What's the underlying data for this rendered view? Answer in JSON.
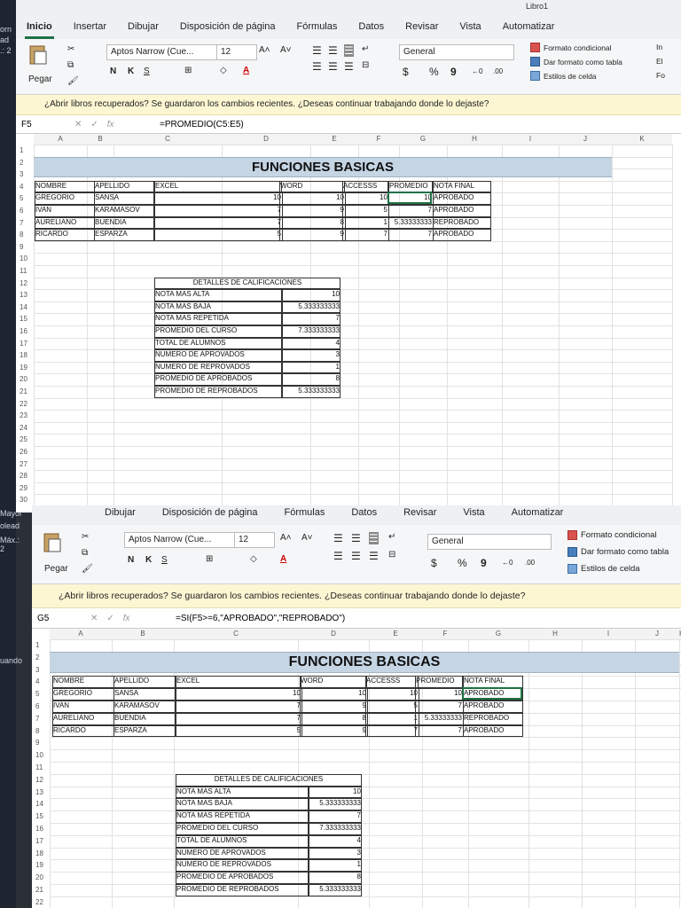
{
  "desktop_fragments": [
    "orn",
    "ad",
    ".: 2",
    "Mayor",
    "olead",
    "Máx.: 2",
    "uando"
  ],
  "window_title": "Libro1",
  "tabs": [
    "Inicio",
    "Insertar",
    "Dibujar",
    "Disposición de página",
    "Fórmulas",
    "Datos",
    "Revisar",
    "Vista",
    "Automatizar"
  ],
  "tabs_w2": [
    "Dibujar",
    "Disposición de página",
    "Fórmulas",
    "Datos",
    "Revisar",
    "Vista",
    "Automatizar"
  ],
  "ribbon": {
    "paste_label": "Pegar",
    "font_name": "Aptos Narrow (Cue...",
    "font_size": "12",
    "bold": "N",
    "italic": "K",
    "underline": "S",
    "number_format": "General",
    "currency": "$",
    "percent": "%",
    "thousands": "9",
    "cond_format": "Formato condicional",
    "table_format": "Dar formato como tabla",
    "cell_styles": "Estilos de celda",
    "insert_partial": "In",
    "delete_partial": "El",
    "format_partial": "Fo"
  },
  "banner_text": "¿Abrir libros recuperados?  Se guardaron los cambios recientes. ¿Deseas continuar trabajando donde lo dejaste?",
  "w1": {
    "namebox": "F5",
    "formula": "=PROMEDIO(C5:E5)"
  },
  "w2": {
    "namebox": "G5",
    "formula": "=SI(F5>=6,\"APROBADO\",\"REPROBADO\")"
  },
  "fx_label": "fx",
  "columns": [
    "A",
    "B",
    "C",
    "D",
    "E",
    "F",
    "G",
    "H",
    "I",
    "J",
    "K"
  ],
  "sheet_title": "FUNCIONES BASICAS",
  "headers": [
    "NOMBRE",
    "APELLIDO",
    "EXCEL",
    "WORD",
    "ACCESSS",
    "PROMEDIO",
    "NOTA FINAL"
  ],
  "students": [
    {
      "nombre": "GREGORIO",
      "apellido": "SANSA",
      "excel": "10",
      "word": "10",
      "access": "10",
      "promedio": "10",
      "nota": "APROBADO"
    },
    {
      "nombre": "IVAN",
      "apellido": "KARAMASOV",
      "excel": "7",
      "word": "9",
      "access": "5",
      "promedio": "7",
      "nota": "APROBADO"
    },
    {
      "nombre": "AURELIANO",
      "apellido": "BUENDIA",
      "excel": "7",
      "word": "8",
      "access": "1",
      "promedio": "5.33333333",
      "nota": "REPROBADO"
    },
    {
      "nombre": "RICARDO",
      "apellido": "ESPARZA",
      "excel": "5",
      "word": "9",
      "access": "7",
      "promedio": "7",
      "nota": "APROBADO"
    }
  ],
  "details_title": "DETALLES DE CALIFICACIONES",
  "details": [
    {
      "label": "NOTA MAS ALTA",
      "value": "10"
    },
    {
      "label": "NOTA MAS BAJA",
      "value": "5.333333333"
    },
    {
      "label": "NOTA MAS REPETIDA",
      "value": "7"
    },
    {
      "label": "PROMEDIO DEL CURSO",
      "value": "7.333333333"
    },
    {
      "label": "TOTAL DE ALUMNOS",
      "value": "4"
    },
    {
      "label": "NUMERO DE APROVADOS",
      "value": "3"
    },
    {
      "label": "NUMERO DE REPROVADOS",
      "value": "1"
    },
    {
      "label": "PROMEDIO DE APROBADOS",
      "value": "8"
    },
    {
      "label": "PROMEDIO DE REPROBADOS",
      "value": "5.333333333"
    }
  ]
}
